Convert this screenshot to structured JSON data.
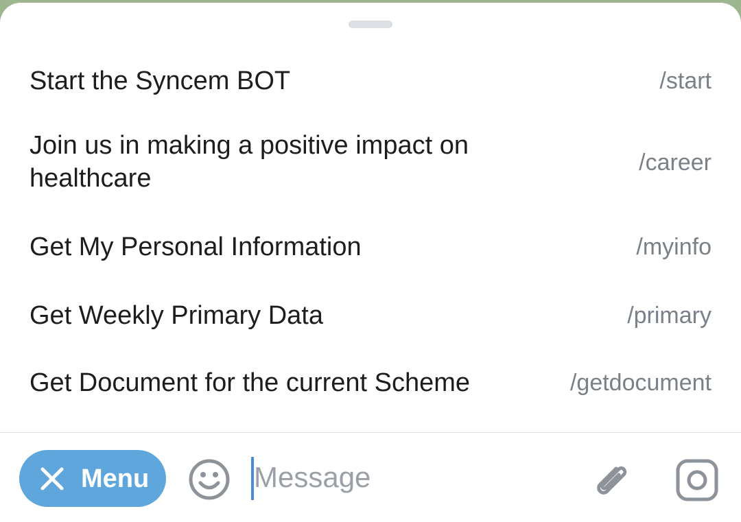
{
  "commands": [
    {
      "description": "Start the Syncem BOT",
      "command": "/start"
    },
    {
      "description_line1": "Join us in making a positive impact on",
      "description_line2": "healthcare",
      "command": "/career"
    },
    {
      "description": "Get My Personal Information",
      "command": "/myinfo"
    },
    {
      "description": "Get Weekly Primary Data",
      "command": "/primary"
    },
    {
      "description": "Get Document for the current Scheme",
      "command": "/getdocument"
    }
  ],
  "input_bar": {
    "menu_label": "Menu",
    "message_placeholder": "Message",
    "icons": [
      "close-icon",
      "emoji-icon",
      "attach-icon",
      "camera-icon"
    ]
  },
  "colors": {
    "accent": "#5ea6dc",
    "text": "#1d1d1f",
    "muted": "#7a8087",
    "icon": "#8e9399"
  }
}
